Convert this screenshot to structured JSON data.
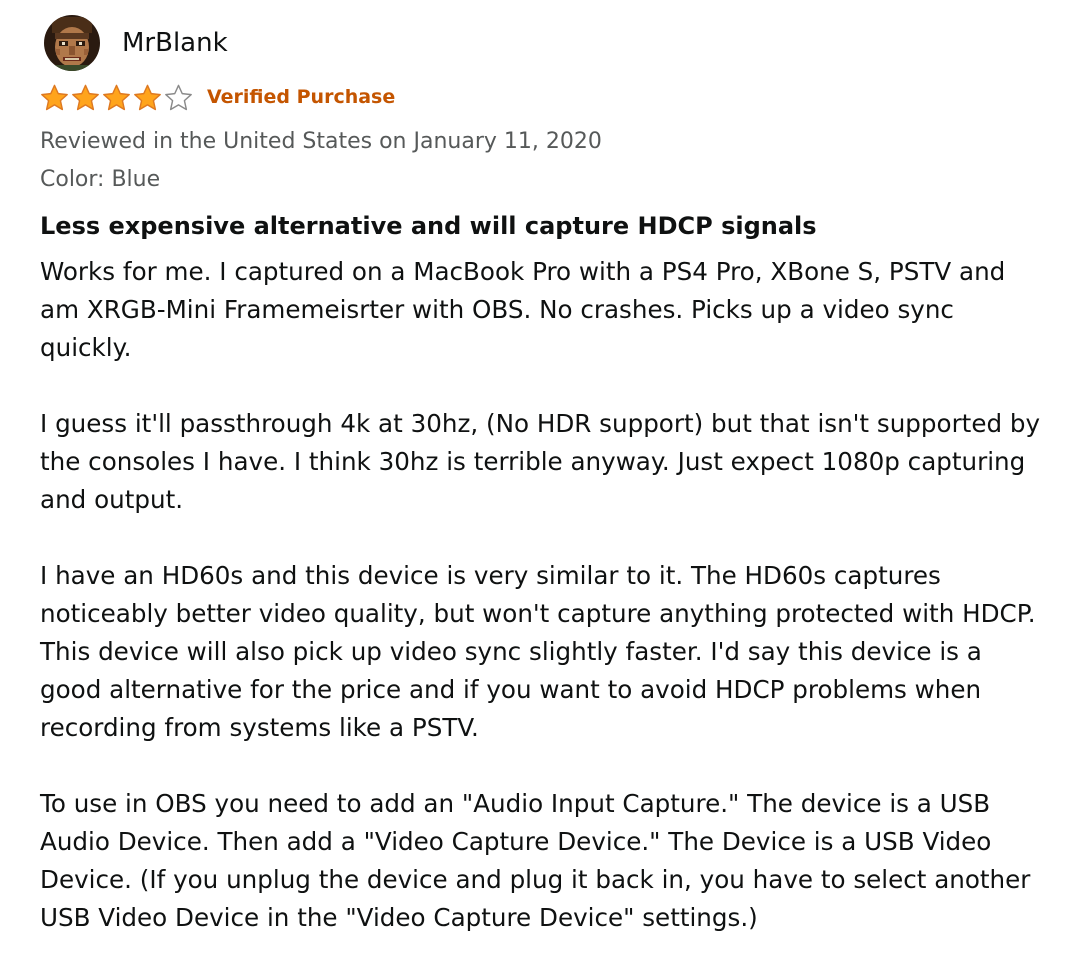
{
  "review": {
    "author": "MrBlank",
    "rating": 4,
    "rating_max": 5,
    "verified_label": "Verified Purchase",
    "date_text": "Reviewed in the United States on January 11, 2020",
    "variant_text": "Color: Blue",
    "title": "Less expensive alternative and will capture HDCP signals",
    "paragraphs": [
      "Works for me. I captured on a MacBook Pro with a PS4 Pro, XBone S, PSTV and am XRGB-Mini Framemeisrter with OBS. No crashes. Picks up a video sync quickly.",
      "I guess it'll passthrough 4k at 30hz, (No HDR support) but that isn't supported by the consoles I have. I think 30hz is terrible anyway. Just expect 1080p capturing and output.",
      "I have an HD60s and this device is very similar to it. The HD60s captures noticeably better video quality, but won't capture anything protected with HDCP. This device will also pick up video sync slightly faster. I'd say this device is a good alternative for the price and if you want to avoid HDCP problems when recording from systems like a PSTV.",
      "To use in OBS you need to add an \"Audio Input Capture.\" The device is a USB Audio Device. Then add a \"Video Capture Device.\" The Device is a USB Video Device. (If you unplug the device and plug it back in, you have to select another USB Video Device in the \"Video Capture Device\" settings.)"
    ]
  },
  "icons": {
    "avatar": "profile-avatar-icon",
    "star_filled": "star-filled-icon",
    "star_empty": "star-empty-icon"
  },
  "colors": {
    "star_fill": "#ffa41c",
    "star_stroke": "#de7921",
    "verified": "#c45500",
    "meta_text": "#565959",
    "body_text": "#0f1111"
  }
}
